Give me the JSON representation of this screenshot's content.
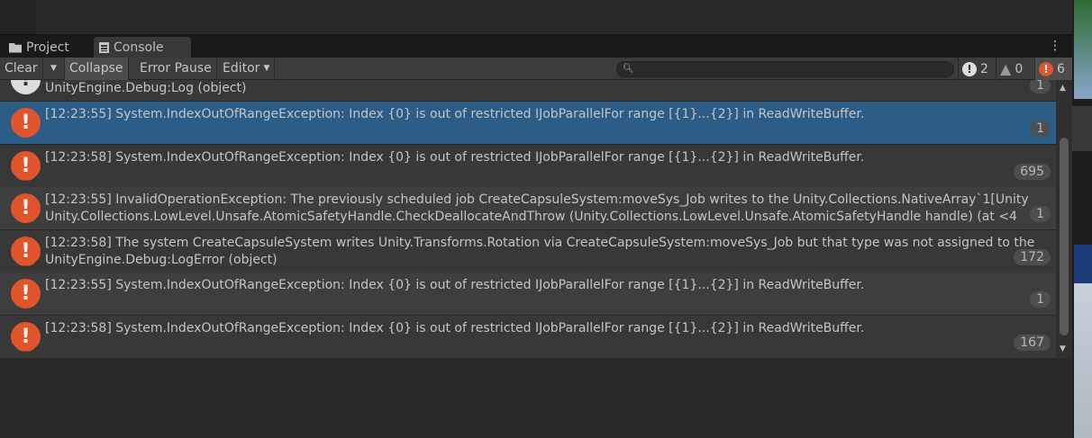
{
  "tabs": [
    {
      "label": "Project",
      "icon": "folder-icon"
    },
    {
      "label": "Console",
      "icon": "console-icon"
    }
  ],
  "toolbar": {
    "clear": "Clear",
    "collapse": "Collapse",
    "error_pause": "Error Pause",
    "editor": "Editor"
  },
  "counts": {
    "log": "2",
    "warning": "0",
    "error": "6"
  },
  "partial_row": {
    "text": "UnityEngine.Debug:Log (object)",
    "count": "1"
  },
  "rows": [
    {
      "line1": "[12:23:55] System.IndexOutOfRangeException: Index {0} is out of restricted IJobParallelFor range [{1}...{2}] in ReadWriteBuffer.",
      "line2": "",
      "count": "1"
    },
    {
      "line1": "[12:23:58] System.IndexOutOfRangeException: Index {0} is out of restricted IJobParallelFor range [{1}...{2}] in ReadWriteBuffer.",
      "line2": "",
      "count": "695"
    },
    {
      "line1": "[12:23:55] InvalidOperationException: The previously scheduled job CreateCapsuleSystem:moveSys_Job writes to the Unity.Collections.NativeArray`1[Unity",
      "line2": "Unity.Collections.LowLevel.Unsafe.AtomicSafetyHandle.CheckDeallocateAndThrow (Unity.Collections.LowLevel.Unsafe.AtomicSafetyHandle handle) (at <4",
      "count": "1"
    },
    {
      "line1": "[12:23:58] The system CreateCapsuleSystem writes Unity.Transforms.Rotation via CreateCapsuleSystem:moveSys_Job but that type was not assigned to the",
      "line2": "UnityEngine.Debug:LogError (object)",
      "count": "172"
    },
    {
      "line1": "[12:23:55] System.IndexOutOfRangeException: Index {0} is out of restricted IJobParallelFor range [{1}...{2}] in ReadWriteBuffer.",
      "line2": "",
      "count": "1"
    },
    {
      "line1": "[12:23:58] System.IndexOutOfRangeException: Index {0} is out of restricted IJobParallelFor range [{1}...{2}] in ReadWriteBuffer.",
      "line2": "",
      "count": "167"
    }
  ],
  "colors": {
    "selected": "#2c5d87",
    "error": "#e0552c"
  }
}
